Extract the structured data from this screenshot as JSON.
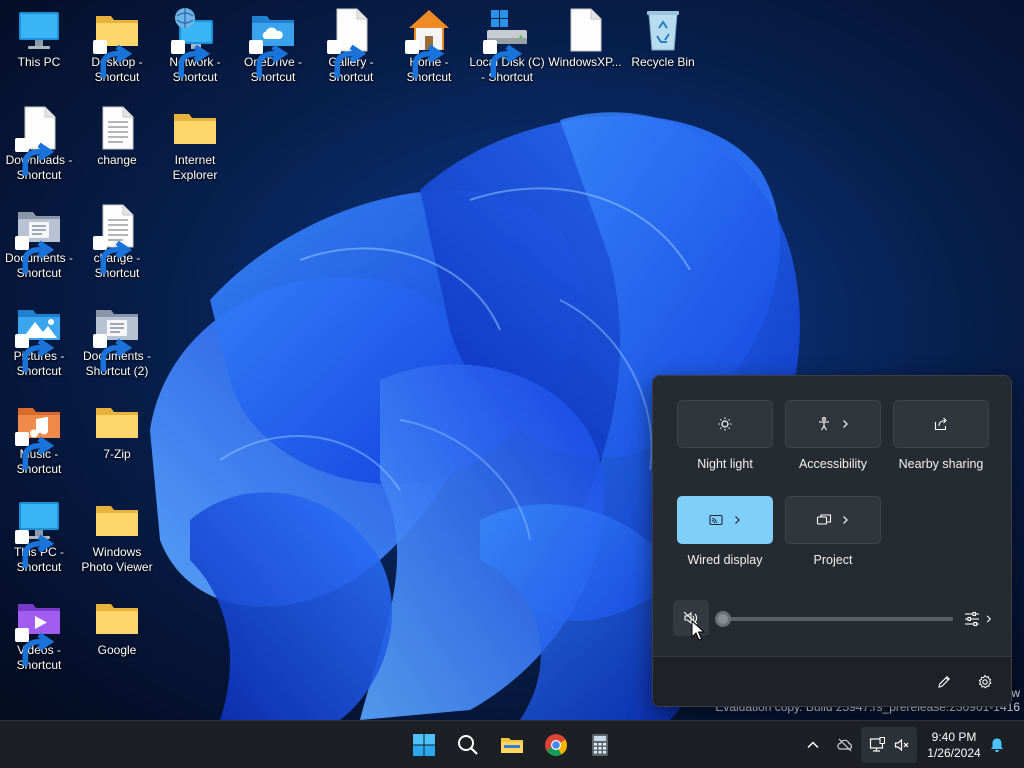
{
  "desktop": {
    "icons": [
      {
        "label": "This PC",
        "kind": "monitor-icon",
        "shortcut": false
      },
      {
        "label": "Desktop - Shortcut",
        "kind": "folder-icon",
        "shortcut": true
      },
      {
        "label": "Network - Shortcut",
        "kind": "network-icon",
        "shortcut": true
      },
      {
        "label": "OneDrive - Shortcut",
        "kind": "onedrive-folder-icon",
        "shortcut": true
      },
      {
        "label": "Gallery - Shortcut",
        "kind": "document-icon",
        "shortcut": true
      },
      {
        "label": "Home - Shortcut",
        "kind": "home-icon",
        "shortcut": true
      },
      {
        "label": "Local Disk (C) - Shortcut",
        "kind": "drive-icon",
        "shortcut": true
      },
      {
        "label": "WindowsXP...",
        "kind": "document-icon",
        "shortcut": false
      },
      {
        "label": "Recycle Bin",
        "kind": "recycle-bin-icon",
        "shortcut": false
      },
      {
        "label": "Downloads - Shortcut",
        "kind": "document-icon",
        "shortcut": true
      },
      {
        "label": "change",
        "kind": "text-file-icon",
        "shortcut": false
      },
      {
        "label": "Internet Explorer",
        "kind": "folder-icon",
        "shortcut": false
      },
      {
        "label": "Documents - Shortcut",
        "kind": "documents-folder-icon",
        "shortcut": true
      },
      {
        "label": "change - Shortcut",
        "kind": "text-file-icon",
        "shortcut": true
      },
      {
        "label": "Pictures - Shortcut",
        "kind": "pictures-folder-icon",
        "shortcut": true
      },
      {
        "label": "Documents - Shortcut (2)",
        "kind": "documents-folder-icon",
        "shortcut": true
      },
      {
        "label": "Music - Shortcut",
        "kind": "music-folder-icon",
        "shortcut": true
      },
      {
        "label": "7-Zip",
        "kind": "folder-icon",
        "shortcut": false
      },
      {
        "label": "This PC - Shortcut",
        "kind": "monitor-icon",
        "shortcut": true
      },
      {
        "label": "Windows Photo Viewer",
        "kind": "folder-icon",
        "shortcut": false
      },
      {
        "label": "Videos - Shortcut",
        "kind": "videos-folder-icon",
        "shortcut": true
      },
      {
        "label": "Google",
        "kind": "folder-icon",
        "shortcut": false
      }
    ]
  },
  "watermark": {
    "line1": "w",
    "line2": "Evaluation copy. Build 25947.rs_prerelease.230901-1416"
  },
  "quick_settings": {
    "tiles": [
      {
        "label": "Night light",
        "icon": "night-light-icon",
        "active": false,
        "has_chevron": false
      },
      {
        "label": "Accessibility",
        "icon": "accessibility-icon",
        "active": false,
        "has_chevron": true
      },
      {
        "label": "Nearby sharing",
        "icon": "share-icon",
        "active": false,
        "has_chevron": false
      },
      {
        "label": "Wired display",
        "icon": "cast-icon",
        "active": true,
        "has_chevron": true
      },
      {
        "label": "Project",
        "icon": "project-icon",
        "active": false,
        "has_chevron": true
      }
    ],
    "volume": {
      "level": 0,
      "muted": true
    },
    "footer": {
      "edit_icon": "pencil-icon",
      "settings_icon": "gear-icon"
    }
  },
  "taskbar": {
    "apps": [
      "start-icon",
      "search-icon",
      "file-explorer-icon",
      "chrome-icon",
      "calculator-icon"
    ],
    "tray": [
      "chevron-up-icon",
      "onedrive-offline-icon",
      "network-icon",
      "volume-muted-icon",
      "notification-bell-icon"
    ],
    "clock": {
      "time": "9:40 PM",
      "date": "1/26/2024"
    }
  },
  "colors": {
    "accent": "#7fcff8",
    "panel": "#262a31",
    "taskbar": "#1c1f24"
  }
}
